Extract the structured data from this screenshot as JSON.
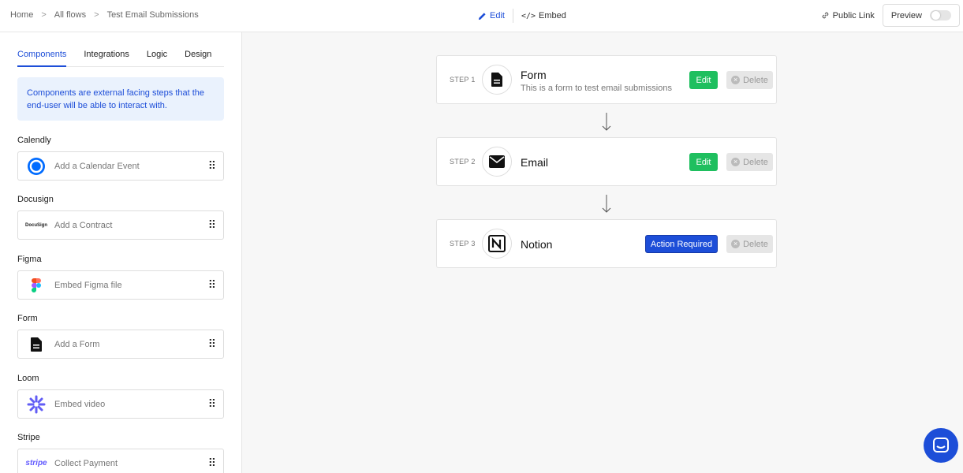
{
  "breadcrumb": [
    "Home",
    "All flows",
    "Test Email Submissions"
  ],
  "center_tabs": {
    "edit": "Edit",
    "embed": "Embed"
  },
  "header": {
    "public_link": "Public Link",
    "preview": "Preview",
    "preview_on": false
  },
  "sidebar": {
    "tabs": [
      "Components",
      "Integrations",
      "Logic",
      "Design"
    ],
    "active_tab": "Components",
    "info": "Components are external facing steps that the end-user will be able to interact with.",
    "sections": [
      {
        "title": "Calendly",
        "item": "Add a Calendar Event",
        "icon": "calendly-icon"
      },
      {
        "title": "Docusign",
        "item": "Add a Contract",
        "icon": "docusign-icon"
      },
      {
        "title": "Figma",
        "item": "Embed Figma file",
        "icon": "figma-icon"
      },
      {
        "title": "Form",
        "item": "Add a Form",
        "icon": "form-icon"
      },
      {
        "title": "Loom",
        "item": "Embed video",
        "icon": "loom-icon"
      },
      {
        "title": "Stripe",
        "item": "Collect Payment",
        "icon": "stripe-icon"
      }
    ],
    "docusign_logo": "DocuSign",
    "stripe_logo": "stripe"
  },
  "steps": [
    {
      "label": "STEP 1",
      "title": "Form",
      "description": "This is a form to test email submissions",
      "action": "Edit",
      "delete": "Delete"
    },
    {
      "label": "STEP 2",
      "title": "Email",
      "description": "",
      "action": "Edit",
      "delete": "Delete"
    },
    {
      "label": "STEP 3",
      "title": "Notion",
      "description": "",
      "action": "Action Required",
      "delete": "Delete"
    }
  ],
  "colors": {
    "accent": "#1d4ed8",
    "success": "#1fbf5f",
    "info_bg": "#eaf2fd"
  }
}
